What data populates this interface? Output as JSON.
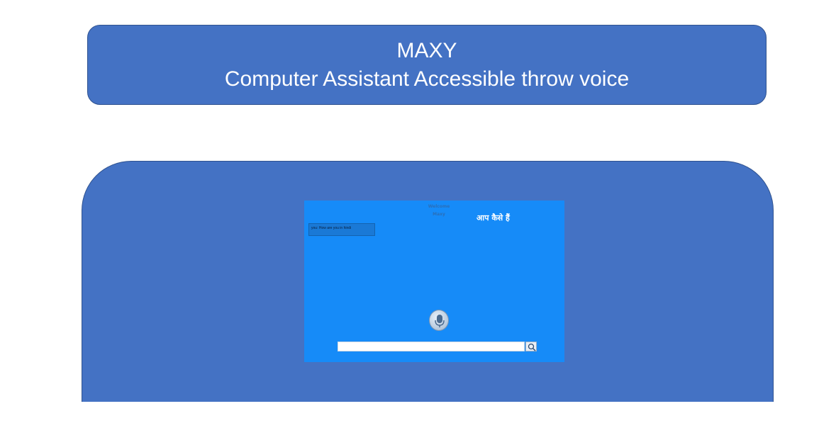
{
  "header": {
    "title": "MAXY",
    "subtitle": "Computer Assistant Accessible throw voice"
  },
  "app": {
    "welcome_line1": "Welcome",
    "welcome_line2": "Maxy",
    "hindi_text": "आप कैसे हैं",
    "chat_message": "you: How are you in hindi",
    "search_placeholder": "",
    "icons": {
      "mic": "microphone-icon",
      "search": "search-icon"
    }
  },
  "colors": {
    "slide_box": "#4472c4",
    "app_background": "#168bf8"
  }
}
